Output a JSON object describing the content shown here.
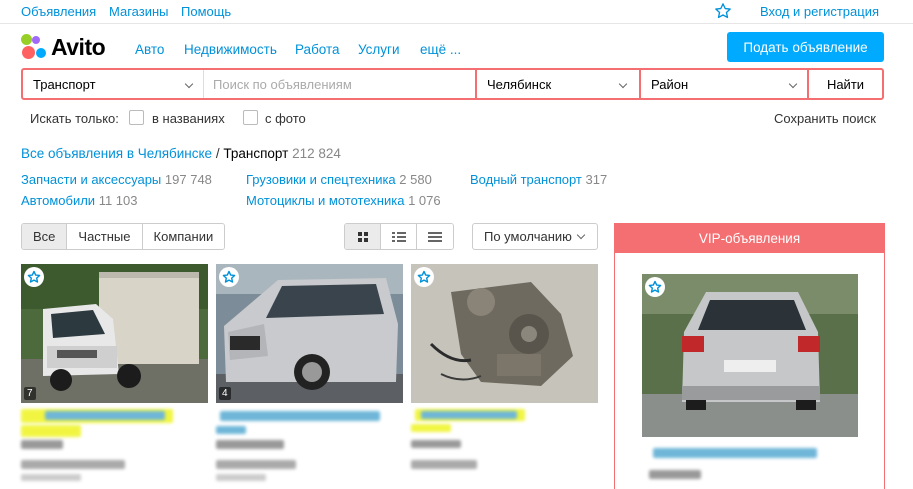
{
  "topbar": {
    "ads": "Объявления",
    "shops": "Магазины",
    "help": "Помощь",
    "login": "Вход и регистрация"
  },
  "header": {
    "logo": "Avito",
    "nav": [
      "Авто",
      "Недвижимость",
      "Работа",
      "Услуги",
      "ещё ..."
    ],
    "post_ad": "Подать объявление"
  },
  "search": {
    "category": "Транспорт",
    "placeholder": "Поиск по объявлениям",
    "city": "Челябинск",
    "district": "Район",
    "submit": "Найти"
  },
  "filters": {
    "only_label": "Искать только:",
    "in_titles": "в названиях",
    "with_photo": "с фото",
    "save_search": "Сохранить поиск"
  },
  "breadcrumb": {
    "all_ads": "Все объявления в Челябинске",
    "separator": "/",
    "current": "Транспорт",
    "count": "212 824"
  },
  "categories": [
    {
      "name": "Запчасти и аксессуары",
      "count": "197 748"
    },
    {
      "name": "Грузовики и спецтехника",
      "count": "2 580"
    },
    {
      "name": "Водный транспорт",
      "count": "317"
    },
    {
      "name": "Автомобили",
      "count": "11 103"
    },
    {
      "name": "Мотоциклы и мототехника",
      "count": "1 076"
    }
  ],
  "tabs": [
    "Все",
    "Частные",
    "Компании"
  ],
  "sort": "По умолчанию",
  "listings": [
    {
      "photo_count": "7",
      "image": "truck"
    },
    {
      "photo_count": "4",
      "image": "suv"
    },
    {
      "image": "part"
    }
  ],
  "vip": {
    "title": "VIP-объявления"
  },
  "colors": {
    "accent": "#0091d9",
    "button": "#00aaff",
    "search_border": "#f36f72",
    "vip_header": "#f36f72",
    "highlight": "#f1f542"
  },
  "icons": [
    "star-icon",
    "chevron-down-icon",
    "grid-view-icon",
    "list-view-icon",
    "compact-view-icon",
    "favorite-star-icon"
  ]
}
